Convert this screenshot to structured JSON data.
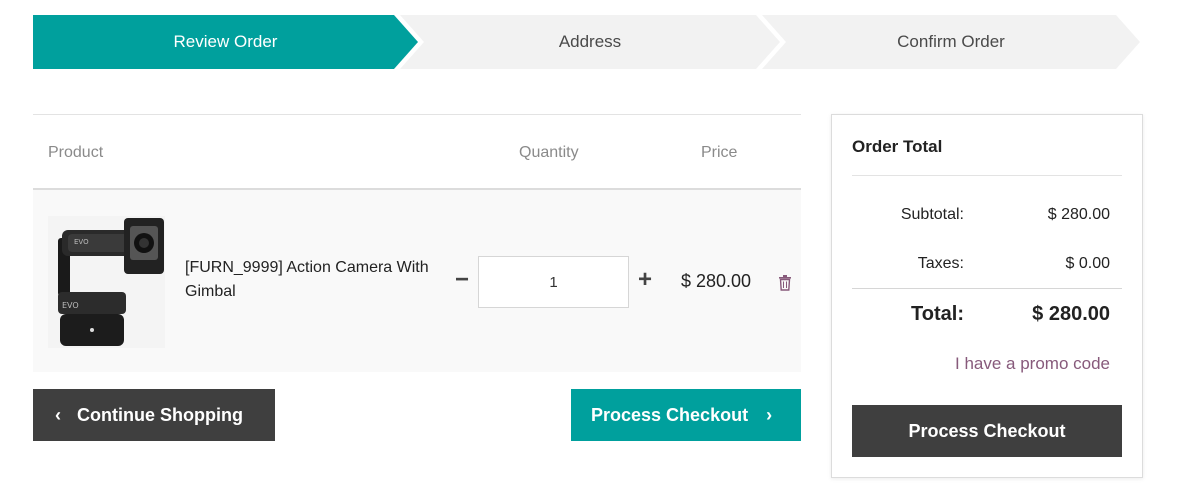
{
  "steps": [
    {
      "label": "Review Order",
      "active": true
    },
    {
      "label": "Address",
      "active": false
    },
    {
      "label": "Confirm Order",
      "active": false
    }
  ],
  "colors": {
    "accent": "#00a09d",
    "dark": "#3f3f3f",
    "step_inactive": "#f2f2f2",
    "promo": "#875a7b"
  },
  "cart": {
    "headers": {
      "product": "Product",
      "quantity": "Quantity",
      "price": "Price"
    },
    "line": {
      "image_icon": "action-camera-gimbal-photo",
      "name": "[FURN_9999] Action Camera With Gimbal",
      "quantity": "1",
      "minus": "−",
      "plus": "+",
      "price": "$ 280.00",
      "remove_icon": "trash-icon"
    }
  },
  "buttons": {
    "continue_chevron": "‹",
    "continue": "Continue Shopping",
    "process": "Process Checkout",
    "process_chevron": "›"
  },
  "summary": {
    "title": "Order Total",
    "subtotal_label": "Subtotal:",
    "subtotal_value": "$ 280.00",
    "taxes_label": "Taxes:",
    "taxes_value": "$ 0.00",
    "total_label": "Total:",
    "total_value": "$ 280.00",
    "promo": "I have a promo code",
    "checkout": "Process Checkout"
  }
}
